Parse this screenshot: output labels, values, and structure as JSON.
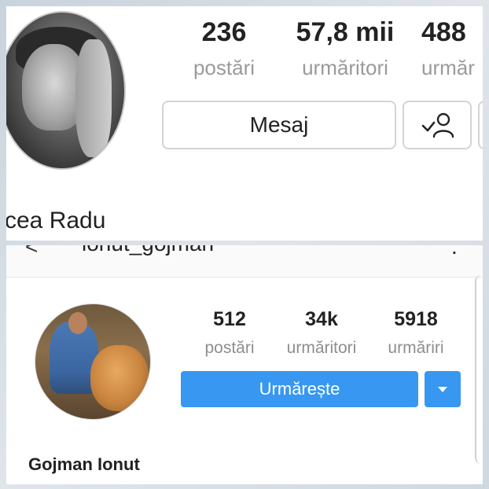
{
  "top_profile": {
    "stats": [
      {
        "value": "236",
        "label": "postări"
      },
      {
        "value": "57,8 mii",
        "label": "urmăritori"
      },
      {
        "value": "488",
        "label": "urmăr"
      }
    ],
    "message_button": "Mesaj",
    "follow_icon": "person-check-icon",
    "name": "cea Radu"
  },
  "bottom_profile": {
    "handle": "ionut_gojman",
    "stats": [
      {
        "value": "512",
        "label": "postări"
      },
      {
        "value": "34k",
        "label": "urmăritori"
      },
      {
        "value": "5918",
        "label": "urmăriri"
      }
    ],
    "follow_button": "Urmărește",
    "dropdown_icon": "caret-down-icon",
    "name": "Gojman Ionut"
  },
  "colors": {
    "accent_blue": "#3897f0",
    "muted_text": "#9a9a9a",
    "border": "#d4d4d4"
  }
}
